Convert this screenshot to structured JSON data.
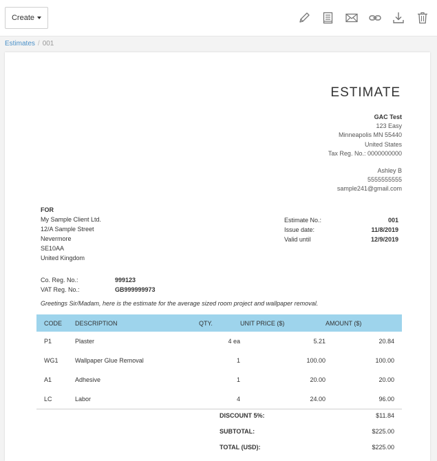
{
  "toolbar": {
    "create_label": "Create",
    "icons": [
      "pencil-icon",
      "document-icon",
      "envelope-icon",
      "link-icon",
      "download-icon",
      "trash-icon"
    ]
  },
  "breadcrumb": {
    "parent": "Estimates",
    "separator": "/",
    "current": "001"
  },
  "document": {
    "title": "ESTIMATE",
    "company": {
      "name": "GAC Test",
      "address1": "123 Easy",
      "address2": "Minneapolis MN 55440",
      "country": "United States",
      "tax_reg": "Tax Reg. No.: 0000000000"
    },
    "contact": {
      "name": "Ashley B",
      "phone": "5555555555",
      "email": "sample241@gmail.com"
    },
    "client": {
      "for_label": "FOR",
      "name": "My Sample Client Ltd.",
      "street": "12/A Sample Street",
      "city": "Nevermore",
      "postcode": "SE10AA",
      "country": "United Kingdom"
    },
    "meta": [
      {
        "label": "Estimate No.:",
        "value": "001"
      },
      {
        "label": "Issue date:",
        "value": "11/8/2019"
      },
      {
        "label": "Valid until",
        "value": "12/9/2019"
      }
    ],
    "registration": [
      {
        "label": "Co. Reg. No.:",
        "value": "999123"
      },
      {
        "label": "VAT Reg. No.:",
        "value": "GB999999973"
      }
    ],
    "greeting": "Greetings Sir/Madam, here is the estimate for the average sized room project and wallpaper removal.",
    "table": {
      "headers": {
        "code": "CODE",
        "description": "DESCRIPTION",
        "qty": "QTY.",
        "unit_price": "UNIT PRICE ($)",
        "amount": "AMOUNT ($)"
      },
      "rows": [
        {
          "code": "P1",
          "description": "Plaster",
          "qty": "4 ea",
          "unit_price": "5.21",
          "amount": "20.84"
        },
        {
          "code": "WG1",
          "description": "Wallpaper Glue Removal",
          "qty": "1",
          "unit_price": "100.00",
          "amount": "100.00"
        },
        {
          "code": "A1",
          "description": "Adhesive",
          "qty": "1",
          "unit_price": "20.00",
          "amount": "20.00"
        },
        {
          "code": "LC",
          "description": "Labor",
          "qty": "4",
          "unit_price": "24.00",
          "amount": "96.00"
        }
      ]
    },
    "totals": [
      {
        "label": "DISCOUNT 5%:",
        "value": "$11.84"
      },
      {
        "label": "SUBTOTAL:",
        "value": "$225.00"
      },
      {
        "label": "TOTAL (USD):",
        "value": "$225.00"
      }
    ]
  },
  "colors": {
    "table_header": "#9ed4ec",
    "link": "#4a90c8"
  }
}
